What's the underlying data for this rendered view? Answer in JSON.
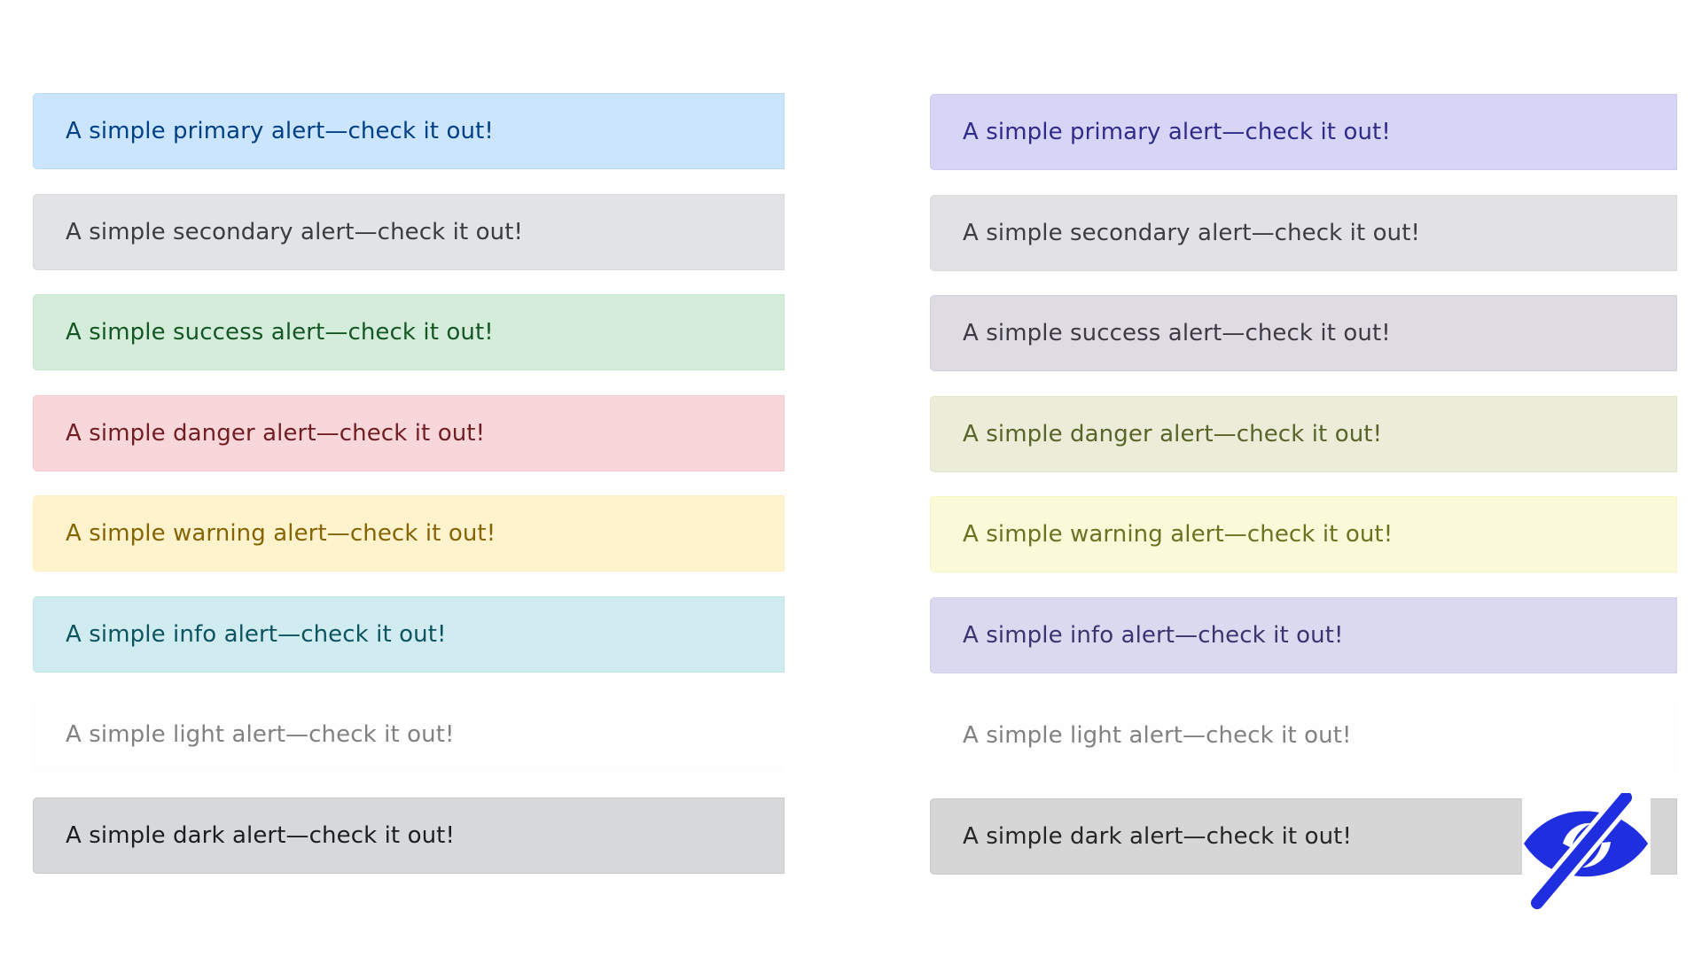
{
  "left_alerts": [
    {
      "text": "A simple primary alert—check it out!",
      "bg": "#cce5ff",
      "border": "#b8daff",
      "color": "#004085"
    },
    {
      "text": "A simple secondary alert—check it out!",
      "bg": "#e2e3e5",
      "border": "#d6d8db",
      "color": "#383d41"
    },
    {
      "text": "A simple success alert—check it out!",
      "bg": "#d4edda",
      "border": "#c3e6cb",
      "color": "#155724"
    },
    {
      "text": "A simple danger alert—check it out!",
      "bg": "#f8d7da",
      "border": "#f5c6cb",
      "color": "#721c24"
    },
    {
      "text": "A simple warning alert—check it out!",
      "bg": "#fff3cd",
      "border": "#ffeeba",
      "color": "#856404"
    },
    {
      "text": "A simple info alert—check it out!",
      "bg": "#d1ecf1",
      "border": "#bee5eb",
      "color": "#0c5460"
    },
    {
      "text": "A simple light alert—check it out!",
      "bg": "#fefefe",
      "border": "#fdfdfe",
      "color": "#818182"
    },
    {
      "text": "A simple dark alert—check it out!",
      "bg": "#d6d8d9",
      "border": "#c6c8ca",
      "color": "#1b1e21"
    }
  ],
  "right_alerts": [
    {
      "text": "A simple primary alert—check it out!",
      "bg": "#d6d5f6",
      "border": "#cccaf2",
      "color": "#2e2b8a"
    },
    {
      "text": "A simple secondary alert—check it out!",
      "bg": "#e2e2e4",
      "border": "#d8d8db",
      "color": "#3d3d42"
    },
    {
      "text": "A simple success alert—check it out!",
      "bg": "#dedce2",
      "border": "#d4d2d9",
      "color": "#3d3a45"
    },
    {
      "text": "A simple danger alert—check it out!",
      "bg": "#ebedd9",
      "border": "#e3e5cb",
      "color": "#5a6328"
    },
    {
      "text": "A simple warning alert—check it out!",
      "bg": "#fbfad8",
      "border": "#f6f5c6",
      "color": "#6b7222"
    },
    {
      "text": "A simple info alert—check it out!",
      "bg": "#dbd9ef",
      "border": "#d1cfea",
      "color": "#3a3570"
    },
    {
      "text": "A simple light alert—check it out!",
      "bg": "#fefefe",
      "border": "#fdfdfe",
      "color": "#818182"
    },
    {
      "text": "A simple dark alert—check it out!",
      "bg": "#d6d6d7",
      "border": "#c9c9cb",
      "color": "#262629"
    }
  ],
  "icon": {
    "name": "eye-slash-icon",
    "color": "#1f2fe0"
  }
}
